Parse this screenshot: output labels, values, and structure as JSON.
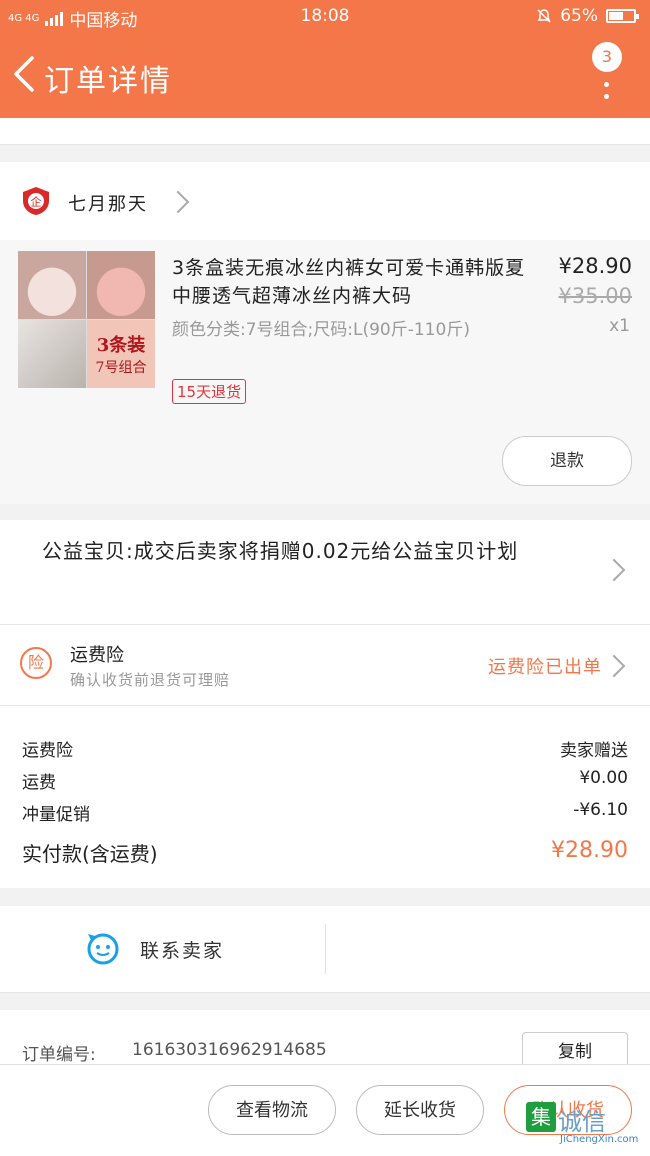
{
  "status_bar": {
    "network": "4G 4G",
    "carrier": "中国移动",
    "time": "18:08",
    "battery": "65%",
    "battery_level": 0.65
  },
  "nav": {
    "title": "订单详情",
    "badge": "3",
    "accent_color": "#f4774a"
  },
  "shop": {
    "icon_text": "企",
    "name": "七月那天"
  },
  "product": {
    "thumb_label_1": "3条装",
    "thumb_label_2": "7号组合",
    "title": "3条盒装无痕冰丝内裤女可爱卡通韩版夏中腰透气超薄冰丝内裤大码",
    "sku": "颜色分类:7号组合;尺码:L(90斤-110斤)",
    "price": "¥28.90",
    "original_price": "¥35.00",
    "quantity": "x1",
    "tag": "15天退货",
    "refund_button": "退款"
  },
  "charity": {
    "text": "公益宝贝:成交后卖家将捐赠0.02元给公益宝贝计划"
  },
  "insurance": {
    "icon_text": "险",
    "title": "运费险",
    "subtitle": "确认收货前退货可理赔",
    "status": "运费险已出单"
  },
  "fees": [
    {
      "label": "运费险",
      "value": "卖家赠送"
    },
    {
      "label": "运费",
      "value": "¥0.00"
    },
    {
      "label": "冲量促销",
      "value": "-¥6.10"
    },
    {
      "label": "实付款(含运费)",
      "value": "¥28.90"
    }
  ],
  "contact": {
    "label": "联系卖家"
  },
  "order": {
    "number_label": "订单编号:",
    "number": "1616303169629146​85",
    "copy_button": "复制"
  },
  "bottom_bar": {
    "logistics_button": "查看物流",
    "extend_button": "延长收货",
    "confirm_button": "确认收货"
  },
  "watermark": {
    "box": "集",
    "text": "诚信",
    "sub": "JiChengXin.com"
  }
}
